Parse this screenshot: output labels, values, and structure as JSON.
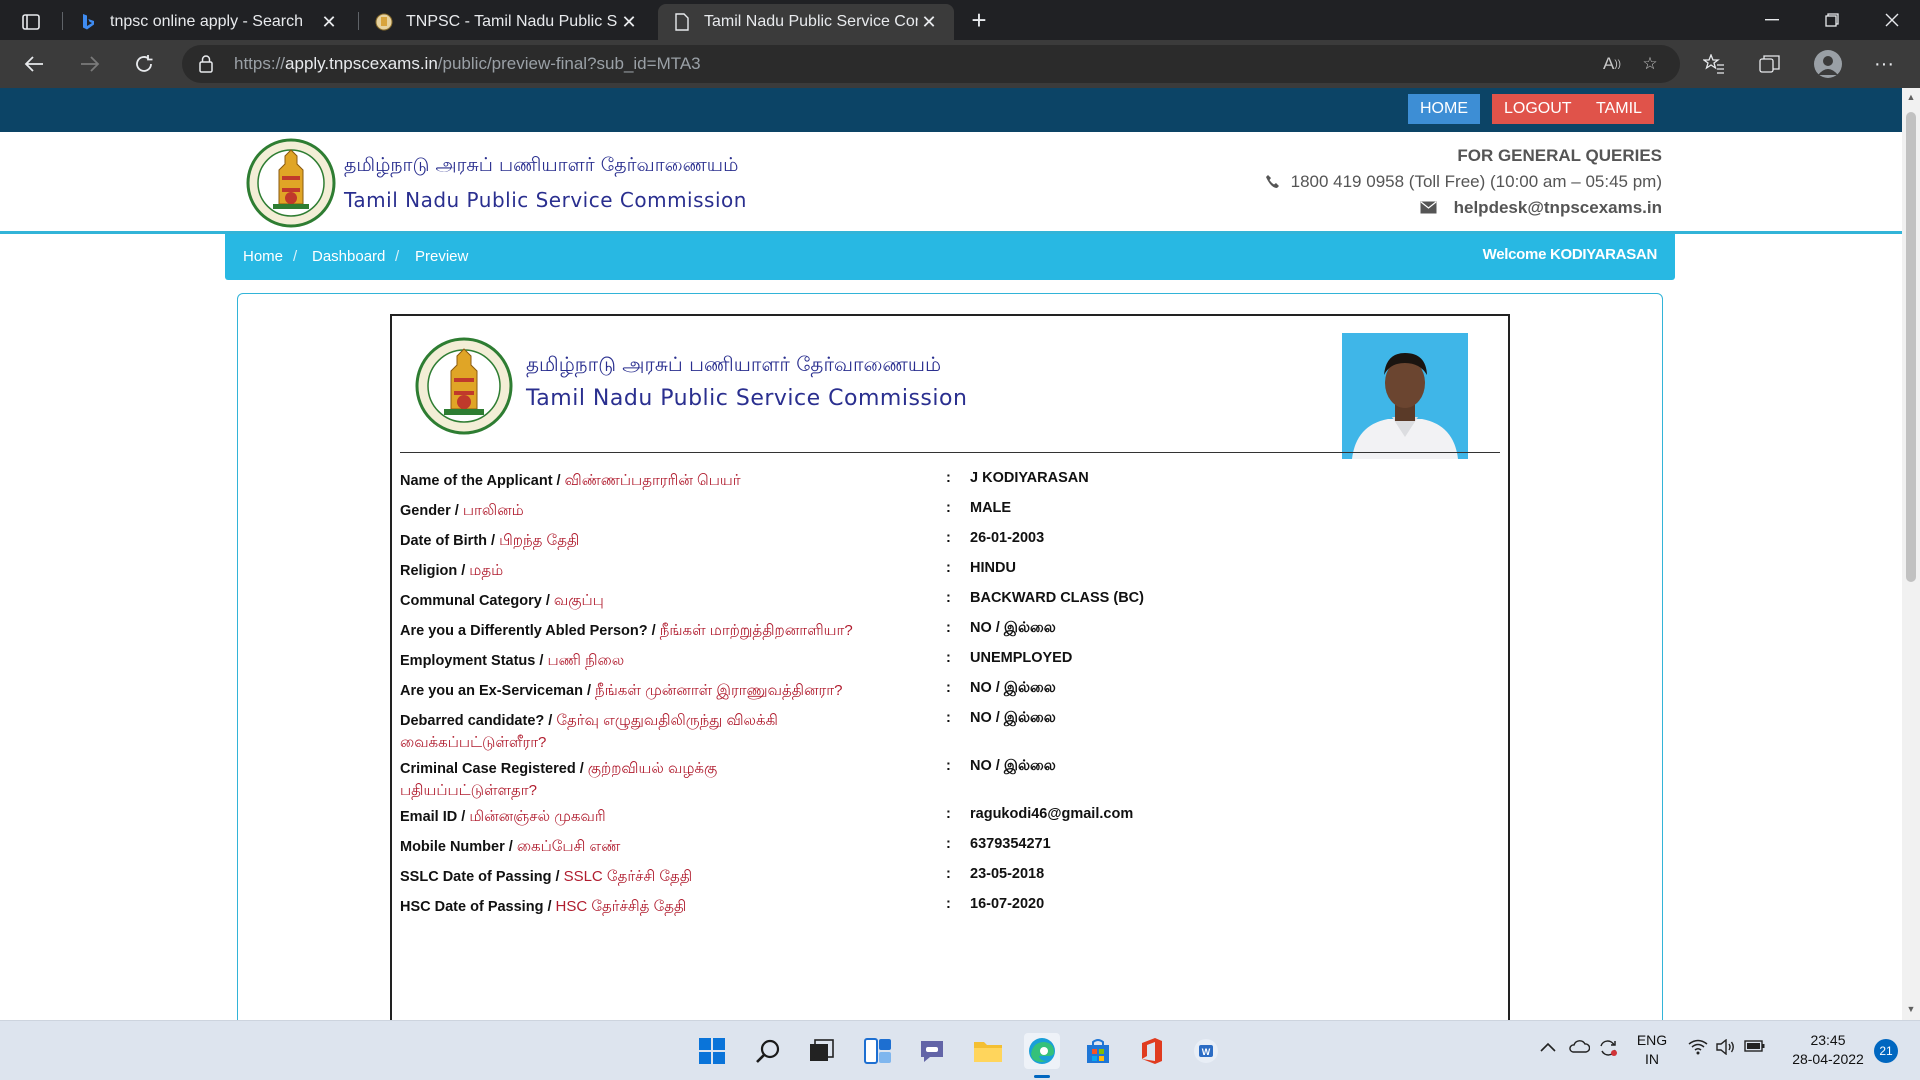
{
  "browser": {
    "tabs": [
      {
        "title": "tnpsc online apply - Search",
        "favicon": "bing-icon",
        "active": false
      },
      {
        "title": "TNPSC - Tamil Nadu Public Servi",
        "favicon": "tnpsc-favicon",
        "active": false
      },
      {
        "title": "Tamil Nadu Public Service Comm",
        "favicon": "page-icon",
        "active": true
      }
    ],
    "url_prefix": "https://",
    "url_host": "apply.tnpscexams.in",
    "url_path": "/public/preview-final?sub_id=MTA3"
  },
  "site": {
    "top_buttons": {
      "home": "HOME",
      "logout": "LOGOUT",
      "tamil": "TAMIL"
    },
    "org_name_ta": "தமிழ்நாடு அரசுப் பணியாளர் தேர்வாணையம்",
    "org_name_en": "Tamil Nadu Public Service Commission",
    "queries_title": "FOR GENERAL QUERIES",
    "phone": "1800 419 0958 (Toll Free)  (10:00 am – 05:45 pm)",
    "email": "helpdesk@tnpscexams.in",
    "breadcrumb": [
      "Home",
      "Dashboard",
      "Preview"
    ],
    "welcome": "Welcome KODIYARASAN"
  },
  "form": {
    "org_name_ta": "தமிழ்நாடு அரசுப் பணியாளர் தேர்வாணையம்",
    "org_name_en": "Tamil Nadu Public Service Commission",
    "rows": [
      {
        "label_en": "Name of the Applicant / ",
        "label_ta": "விண்ணப்பதாரரின் பெயர்",
        "value": "J KODIYARASAN"
      },
      {
        "label_en": "Gender / ",
        "label_ta": "பாலினம்",
        "value": "MALE"
      },
      {
        "label_en": "Date of Birth / ",
        "label_ta": "பிறந்த தேதி",
        "value": "26-01-2003"
      },
      {
        "label_en": "Religion / ",
        "label_ta": "மதம்",
        "value": "HINDU"
      },
      {
        "label_en": "Communal Category / ",
        "label_ta": "வகுப்பு",
        "value": "BACKWARD CLASS (BC)"
      },
      {
        "label_en": "Are you a Differently Abled Person? / ",
        "label_ta": "நீங்கள் மாற்றுத்திறனாளியா?",
        "value": "NO / இல்லை"
      },
      {
        "label_en": "Employment Status / ",
        "label_ta": "பணி நிலை",
        "value": "UNEMPLOYED"
      },
      {
        "label_en": "Are you an Ex-Serviceman / ",
        "label_ta": "நீங்கள் முன்னாள் இராணுவத்தினரா?",
        "value": "NO / இல்லை"
      },
      {
        "label_en": "Debarred candidate? / ",
        "label_ta": "தேர்வு எழுதுவதிலிருந்து விலக்கி வைக்கப்பட்டுள்ளீரா?",
        "value": "NO / இல்லை"
      },
      {
        "label_en": "Criminal Case Registered / ",
        "label_ta": "குற்றவியல் வழக்கு பதியப்பட்டுள்ளதா?",
        "value": "NO / இல்லை"
      },
      {
        "label_en": "Email ID / ",
        "label_ta": "மின்னஞ்சல் முகவரி",
        "value": "ragukodi46@gmail.com"
      },
      {
        "label_en": "Mobile Number / ",
        "label_ta": "கைப்பேசி எண்",
        "value": "6379354271"
      },
      {
        "label_en": "SSLC Date of Passing / ",
        "label_ta": "SSLC தேர்ச்சி தேதி",
        "value": "23-05-2018"
      },
      {
        "label_en": "HSC Date of Passing / ",
        "label_ta": "HSC தேர்ச்சித் தேதி",
        "value": "16-07-2020"
      }
    ],
    "colon": ":"
  },
  "taskbar": {
    "lang_top": "ENG",
    "lang_bottom": "IN",
    "time": "23:45",
    "date": "28-04-2022",
    "notifications": "21"
  },
  "colors": {
    "topbar": "#0c4466",
    "accent": "#28b8e3",
    "tamil_label": "#b01c2e",
    "org_name": "#2a2f8f"
  }
}
